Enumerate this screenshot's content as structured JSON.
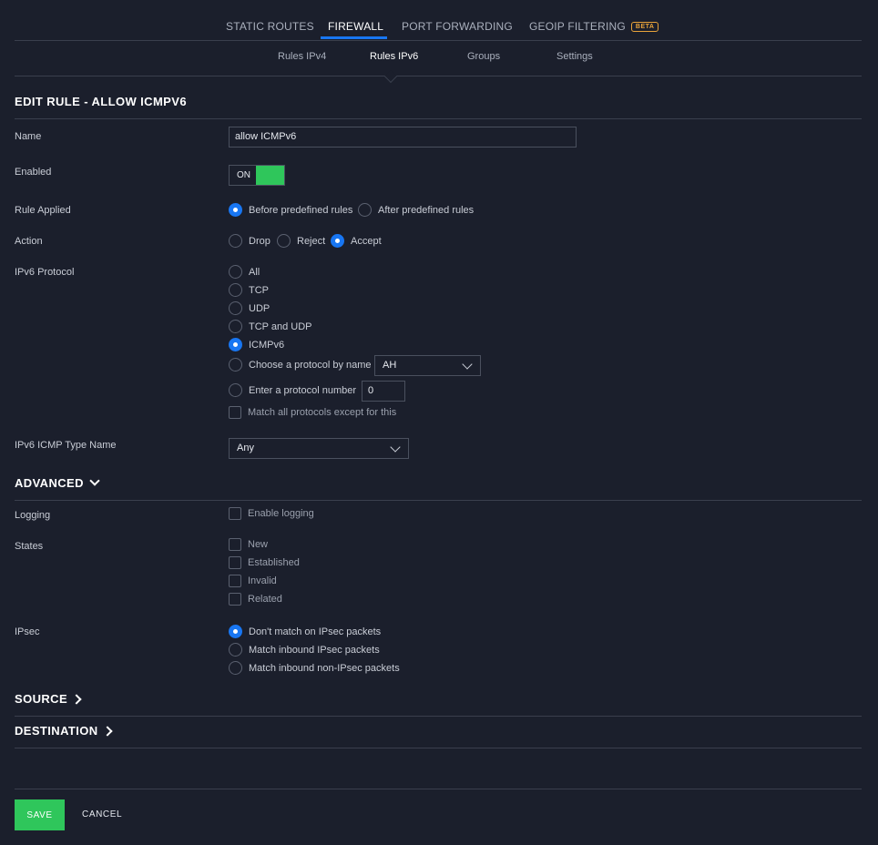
{
  "tabs": {
    "static_routes": "STATIC ROUTES",
    "firewall": "FIREWALL",
    "port_forwarding": "PORT FORWARDING",
    "geoip": "GEOIP FILTERING",
    "beta": "BETA"
  },
  "subtabs": {
    "rules_ipv4": "Rules IPv4",
    "rules_ipv6": "Rules IPv6",
    "groups": "Groups",
    "settings": "Settings"
  },
  "form": {
    "title": "EDIT RULE - ALLOW ICMPV6",
    "name_label": "Name",
    "name_value": "allow ICMPv6",
    "enabled_label": "Enabled",
    "enabled_state": "ON",
    "rule_applied_label": "Rule Applied",
    "rule_applied_before": "Before predefined rules",
    "rule_applied_after": "After predefined rules",
    "action_label": "Action",
    "action_drop": "Drop",
    "action_reject": "Reject",
    "action_accept": "Accept",
    "protocol_label": "IPv6 Protocol",
    "protocol_all": "All",
    "protocol_tcp": "TCP",
    "protocol_udp": "UDP",
    "protocol_tcp_udp": "TCP and UDP",
    "protocol_icmpv6": "ICMPv6",
    "protocol_by_name": "Choose a protocol by name",
    "protocol_by_name_value": "AH",
    "protocol_by_number": "Enter a protocol number",
    "protocol_number_value": "0",
    "protocol_match_except": "Match all protocols except for this",
    "icmp_type_label": "IPv6 ICMP Type Name",
    "icmp_type_value": "Any"
  },
  "advanced": {
    "title": "ADVANCED",
    "logging_label": "Logging",
    "logging_option": "Enable logging",
    "states_label": "States",
    "state_new": "New",
    "state_established": "Established",
    "state_invalid": "Invalid",
    "state_related": "Related",
    "ipsec_label": "IPsec",
    "ipsec_dont_match": "Don't match on IPsec packets",
    "ipsec_inbound": "Match inbound IPsec packets",
    "ipsec_non_ipsec": "Match inbound non-IPsec packets"
  },
  "sections": {
    "source": "SOURCE",
    "destination": "DESTINATION"
  },
  "footer": {
    "save": "SAVE",
    "cancel": "CANCEL"
  },
  "colors": {
    "background": "#1b1f2c",
    "accent_blue": "#1876f2",
    "success_green": "#2fc65b",
    "beta_orange": "#e8a33a"
  }
}
